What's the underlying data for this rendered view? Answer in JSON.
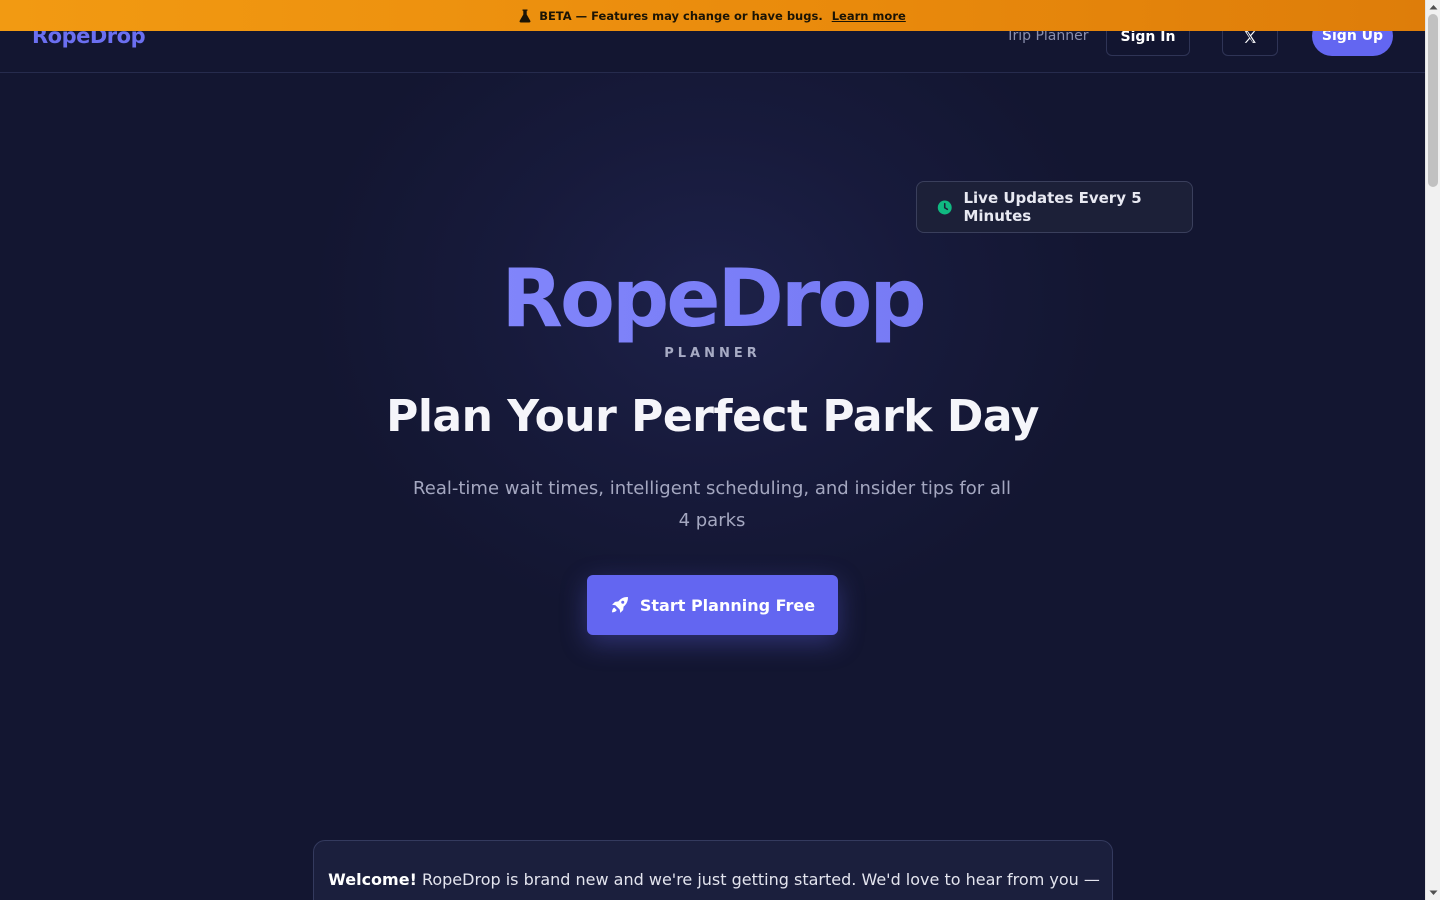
{
  "beta_banner": {
    "text": "BETA — Features may change or have bugs.",
    "link": "Learn more",
    "icon": "flask-icon",
    "color": "#f29a12"
  },
  "nav": {
    "brand": "RopeDrop",
    "links": [
      "Trip Planner"
    ],
    "sign_in": "Sign In",
    "social_icon": "x-logo-icon",
    "sign_up": "Sign Up"
  },
  "live_badge": {
    "text": "Live Updates Every 5 Minutes",
    "icon": "clock-icon",
    "icon_color": "#10b981"
  },
  "hero": {
    "logo": "RopeDrop",
    "tagline": "PLANNER",
    "title": "Plan Your Perfect Park Day",
    "description": "Real-time wait times, intelligent scheduling, and insider tips for all 4 parks",
    "cta": "Start Planning Free",
    "cta_icon": "rocket-icon"
  },
  "welcome": {
    "lead": "Welcome!",
    "text": " RopeDrop is brand new and we're just getting started. We'd love to hear from you —"
  },
  "colors": {
    "accent": "#6366f1",
    "background": "#131631"
  }
}
